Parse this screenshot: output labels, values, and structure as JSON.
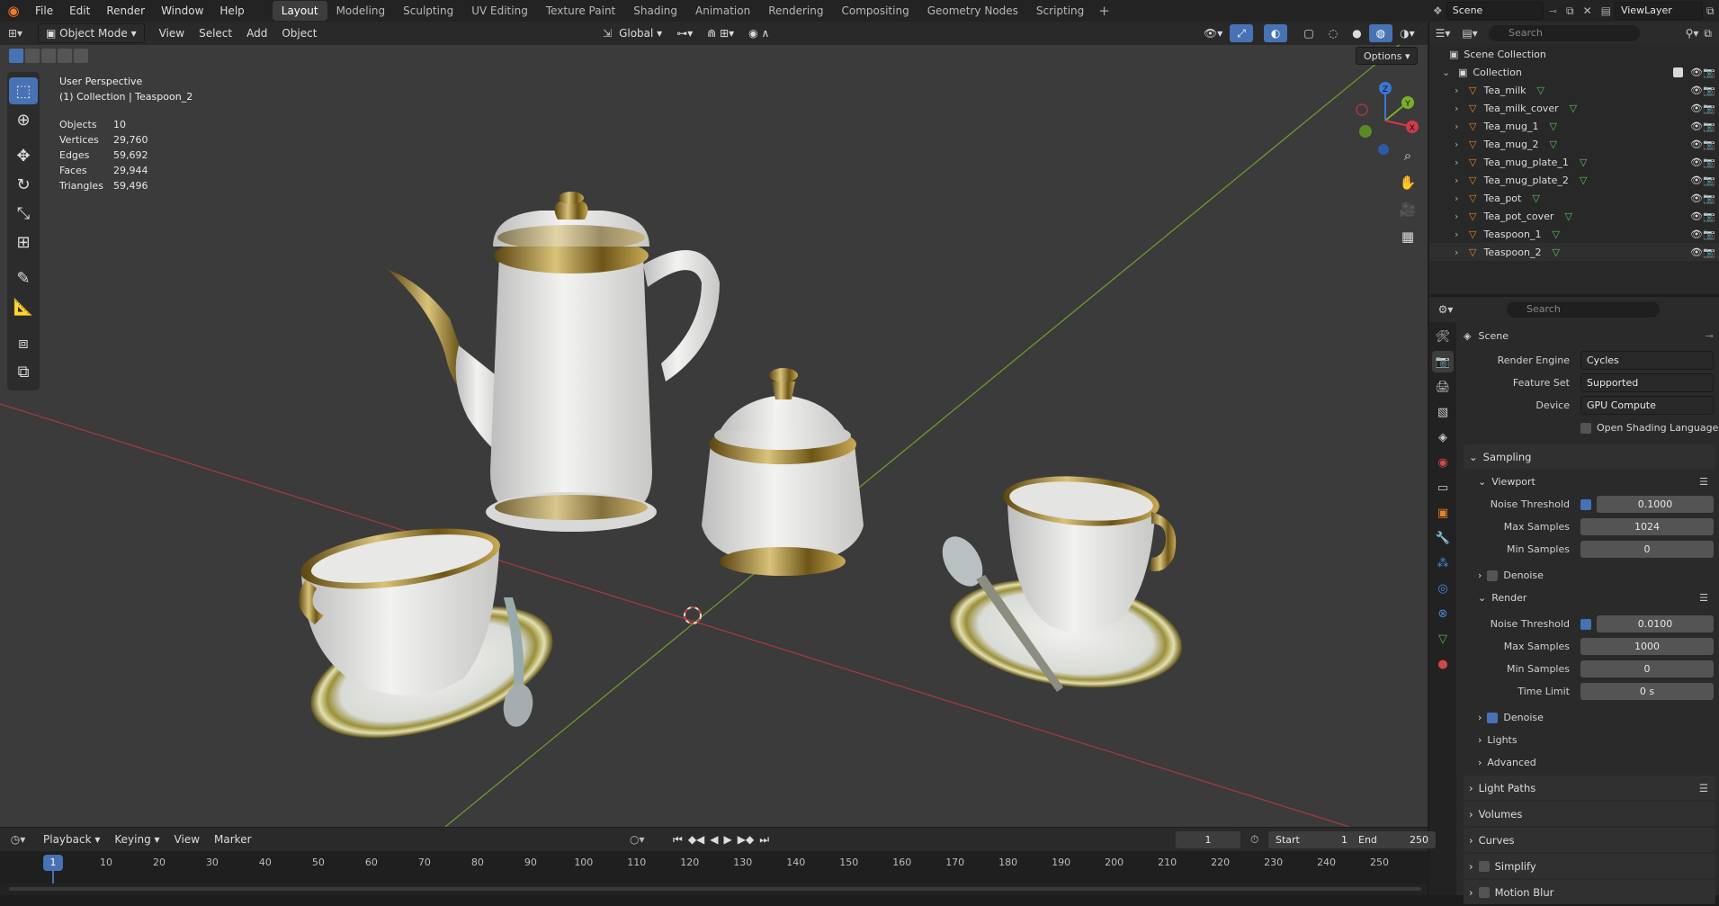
{
  "topbar": {
    "menus": [
      "File",
      "Edit",
      "Render",
      "Window",
      "Help"
    ],
    "workspaces": [
      "Layout",
      "Modeling",
      "Sculpting",
      "UV Editing",
      "Texture Paint",
      "Shading",
      "Animation",
      "Rendering",
      "Compositing",
      "Geometry Nodes",
      "Scripting"
    ],
    "active_workspace": "Layout",
    "scene_name": "Scene",
    "view_layer": "ViewLayer"
  },
  "viewport": {
    "mode": "Object Mode",
    "menus": [
      "View",
      "Select",
      "Add",
      "Object"
    ],
    "orientation": "Global",
    "options_label": "Options",
    "perspective": "User Perspective",
    "context": "(1) Collection | Teaspoon_2",
    "stats": [
      {
        "label": "Objects",
        "value": "10"
      },
      {
        "label": "Vertices",
        "value": "29,760"
      },
      {
        "label": "Edges",
        "value": "59,692"
      },
      {
        "label": "Faces",
        "value": "29,944"
      },
      {
        "label": "Triangles",
        "value": "59,496"
      }
    ],
    "gizmo_axes": [
      "Z",
      "Y",
      "X"
    ]
  },
  "outliner": {
    "search_placeholder": "Search",
    "root": "Scene Collection",
    "collection": "Collection",
    "objects": [
      "Tea_milk",
      "Tea_milk_cover",
      "Tea_mug_1",
      "Tea_mug_2",
      "Tea_mug_plate_1",
      "Tea_mug_plate_2",
      "Tea_pot",
      "Tea_pot_cover",
      "Teaspoon_1",
      "Teaspoon_2"
    ]
  },
  "properties": {
    "search_placeholder": "Search",
    "scene_label": "Scene",
    "render_engine_label": "Render Engine",
    "render_engine": "Cycles",
    "feature_set_label": "Feature Set",
    "feature_set": "Supported",
    "device_label": "Device",
    "device": "GPU Compute",
    "osl_label": "Open Shading Language",
    "sampling": "Sampling",
    "viewport": "Viewport",
    "noise_threshold_label": "Noise Threshold",
    "vp_noise_threshold": "0.1000",
    "max_samples_label": "Max Samples",
    "vp_max_samples": "1024",
    "min_samples_label": "Min Samples",
    "vp_min_samples": "0",
    "denoise_label": "Denoise",
    "render": "Render",
    "r_noise_threshold": "0.0100",
    "r_max_samples": "1000",
    "r_min_samples": "0",
    "time_limit_label": "Time Limit",
    "r_time_limit": "0 s",
    "lights": "Lights",
    "advanced": "Advanced",
    "light_paths": "Light Paths",
    "volumes": "Volumes",
    "curves": "Curves",
    "simplify": "Simplify",
    "motion_blur": "Motion Blur"
  },
  "timeline": {
    "menus": [
      "Playback",
      "Keying",
      "View",
      "Marker"
    ],
    "current_frame": "1",
    "start_label": "Start",
    "start": "1",
    "end_label": "End",
    "end": "250",
    "ticks": [
      "10",
      "20",
      "30",
      "40",
      "50",
      "60",
      "70",
      "80",
      "90",
      "100",
      "110",
      "120",
      "130",
      "140",
      "150",
      "160",
      "170",
      "180",
      "190",
      "200",
      "210",
      "220",
      "230",
      "240",
      "250"
    ],
    "playhead": "1"
  }
}
